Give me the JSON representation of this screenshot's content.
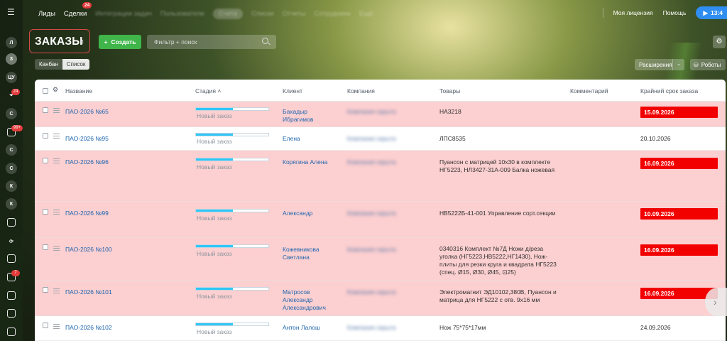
{
  "topnav": {
    "items": [
      "Лиды",
      "Сделки"
    ],
    "deals_badge": "24",
    "hidden_items": [
      "Интеграции задач",
      "Пользователи",
      "Счета",
      "Списки",
      "Отчеты",
      "Сотрудники",
      "Ещё"
    ],
    "license": "Моя лицензия",
    "help": "Помощь",
    "clock": "13:4"
  },
  "leftrail": {
    "items": [
      "Л",
      "З",
      "ЦУ",
      "С",
      "С",
      "С",
      "С",
      "К",
      "К"
    ],
    "badges": [
      "24",
      "99+",
      "7"
    ]
  },
  "page": {
    "title": "ЗАКАЗЫ",
    "create_label": "Создать",
    "search_placeholder": "Фильтр + поиск",
    "view_kanban": "Канбан",
    "view_list": "Список",
    "extensions": "Расширения",
    "robots": "Роботы"
  },
  "grid": {
    "headers": {
      "name": "Название",
      "stage": "Стадия",
      "client": "Клиент",
      "company": "Компания",
      "goods": "Товары",
      "comment": "Комментарий",
      "deadline": "Крайний срок заказа"
    },
    "rows": [
      {
        "name": "ПАО-2026 №65",
        "stage": "Новый заказ",
        "client": "Бахадыр Ибрагимов",
        "company": "Компания скрыта",
        "goods": "НА3218",
        "deadline": "15.09.2026",
        "overdue": true
      },
      {
        "name": "ПАО-2026 №95",
        "stage": "Новый заказ",
        "client": "Елена",
        "company": "Компания скрыта",
        "goods": "ЛПС8535",
        "deadline": "20.10.2026",
        "overdue": false
      },
      {
        "name": "ПАО-2026 №96",
        "stage": "Новый заказ",
        "client": "Корягина Алена",
        "company": "Компания скрыта",
        "goods": "Пуансон с матрицей 10х30 в комплекте НГ5223, НЛ3427-31А-009 Балка ножевая",
        "deadline": "16.09.2026",
        "overdue": true
      },
      {
        "name": "ПАО-2026 №99",
        "stage": "Новый заказ",
        "client": "Александр",
        "company": "Компания скрыта",
        "goods": "НВ5222Б-41-001 Управление сорт.секции",
        "deadline": "10.09.2026",
        "overdue": true
      },
      {
        "name": "ПАО-2026 №100",
        "stage": "Новый заказ",
        "client": "Кожевникова Светлана",
        "company": "Компания скрыта",
        "goods": "0340316 Комплект №7Д Ножи д/реза уголка (НГ5223,НВ5222,НГ1430), Нож-плиты для резки круга и квадрата НГ5223 (спец. Ø15, Ø30, Ø45, ⊡25)",
        "deadline": "16.09.2026",
        "overdue": true
      },
      {
        "name": "ПАО-2026 №101",
        "stage": "Новый заказ",
        "client": "Матросов Александр Александрович",
        "company": "Компания скрыта",
        "goods": "Электромагнит ЭД10102,380В, Пуансон и матрица для НГ5222 с отв. 9х16 мм",
        "deadline": "16.09.2026",
        "overdue": true
      },
      {
        "name": "ПАО-2026 №102",
        "stage": "Новый заказ",
        "client": "Антон Лалош",
        "company": "Компания скрыта",
        "goods": "Нож 75*75*17мм",
        "deadline": "24.09.2026",
        "overdue": false
      }
    ]
  }
}
